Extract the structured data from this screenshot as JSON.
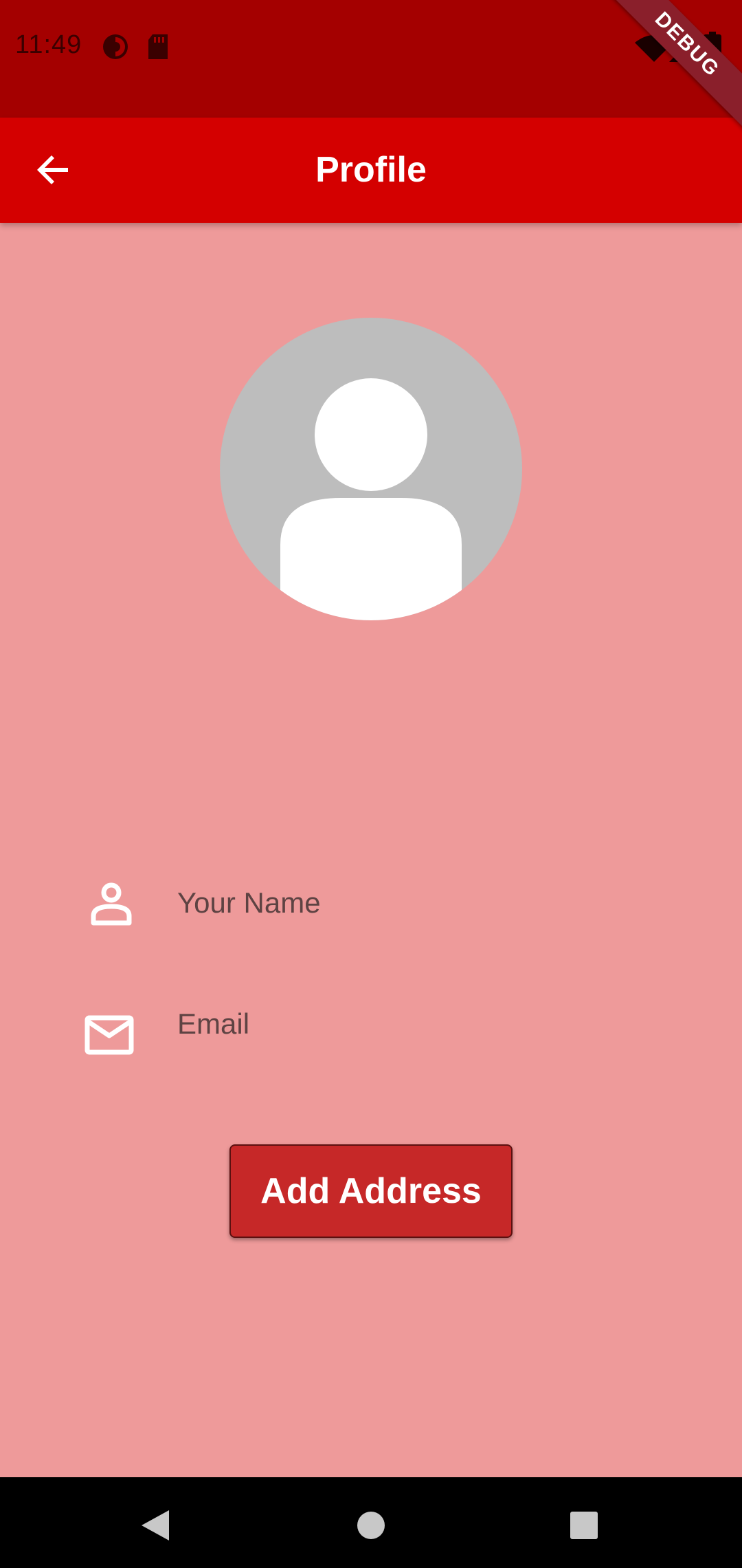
{
  "status_bar": {
    "time": "11:49",
    "icons": [
      "circle-badge-icon",
      "sd-card-icon",
      "wifi-icon",
      "signal-icon",
      "battery-icon"
    ]
  },
  "debug_banner": "DEBUG",
  "app_bar": {
    "title": "Profile",
    "back_icon": "arrow-back-icon"
  },
  "avatar": {
    "icon": "person-placeholder-icon"
  },
  "form": {
    "name": {
      "icon": "person-outline-icon",
      "placeholder": "Your Name",
      "value": ""
    },
    "email": {
      "icon": "mail-outline-icon",
      "placeholder": "Email",
      "value": ""
    }
  },
  "actions": {
    "add_address_label": "Add Address"
  },
  "nav_bar": {
    "icons": [
      "back-triangle-icon",
      "home-circle-icon",
      "recents-square-icon"
    ]
  },
  "colors": {
    "status_bar": "#a40000",
    "app_bar": "#d40000",
    "background": "#ee9a9a",
    "button": "#c62828",
    "avatar_bg": "#bdbdbd"
  }
}
